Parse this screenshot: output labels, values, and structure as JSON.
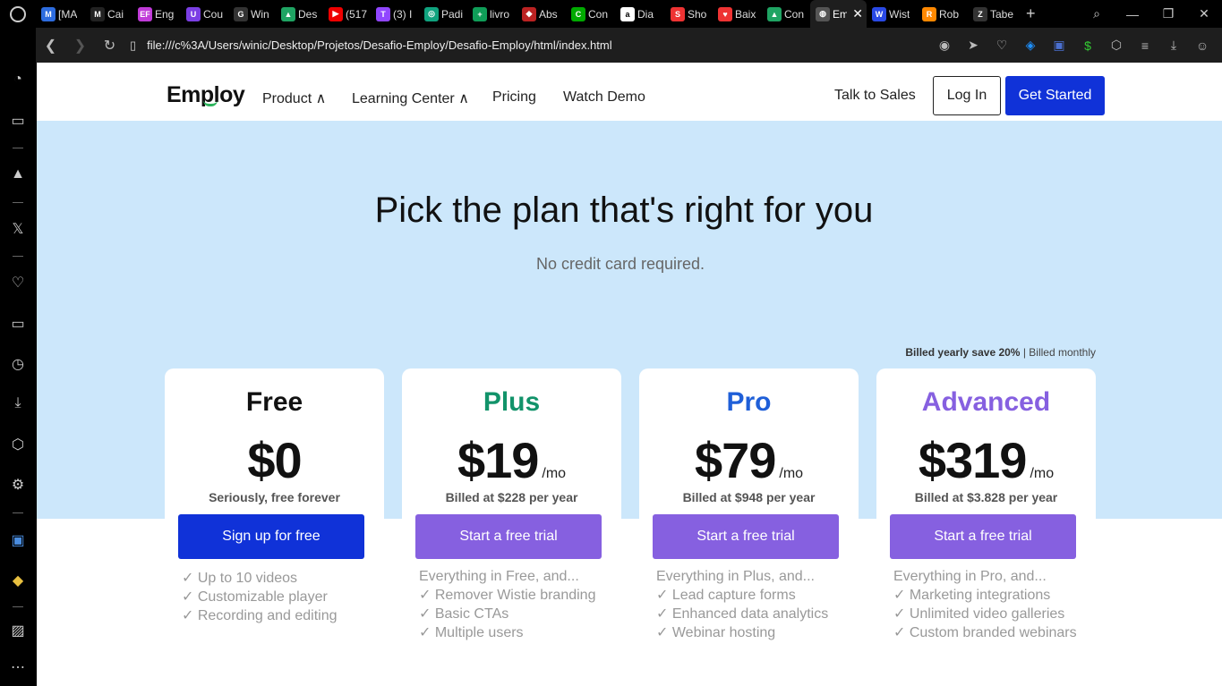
{
  "browser": {
    "tabs": [
      {
        "label": "[MA",
        "fav_color": "#2d6cdf",
        "fav_text": "M"
      },
      {
        "label": "Cai",
        "fav_color": "#222",
        "fav_text": "M"
      },
      {
        "label": "Eng",
        "fav_color": "#c03bd8",
        "fav_text": "EF"
      },
      {
        "label": "Cou",
        "fav_color": "#7b3fe4",
        "fav_text": "U"
      },
      {
        "label": "Win",
        "fav_color": "#333",
        "fav_text": "G"
      },
      {
        "label": "Des",
        "fav_color": "#1fa463",
        "fav_text": "▲"
      },
      {
        "label": "(517",
        "fav_color": "#e00",
        "fav_text": "▶"
      },
      {
        "label": "(3) I",
        "fav_color": "#9146ff",
        "fav_text": "T"
      },
      {
        "label": "Padi",
        "fav_color": "#10a37f",
        "fav_text": "◎"
      },
      {
        "label": "livro",
        "fav_color": "#0f9d58",
        "fav_text": "+"
      },
      {
        "label": "Abs",
        "fav_color": "#b22",
        "fav_text": "◆"
      },
      {
        "label": "Con",
        "fav_color": "#0a0",
        "fav_text": "C"
      },
      {
        "label": "Dia",
        "fav_color": "#fff",
        "fav_text": "a"
      },
      {
        "label": "Sho",
        "fav_color": "#e33",
        "fav_text": "S"
      },
      {
        "label": "Baix",
        "fav_color": "#e33",
        "fav_text": "♥"
      },
      {
        "label": "Con",
        "fav_color": "#1fa463",
        "fav_text": "▲"
      },
      {
        "label": "Em",
        "fav_color": "#555",
        "fav_text": "◍",
        "active": true
      },
      {
        "label": "Wist",
        "fav_color": "#2949e5",
        "fav_text": "W"
      },
      {
        "label": "Rob",
        "fav_color": "#f80",
        "fav_text": "R"
      },
      {
        "label": "Tabe",
        "fav_color": "#333",
        "fav_text": "Z"
      }
    ],
    "new_tab": "+",
    "url": "file:///c%3A/Users/winic/Desktop/Projetos/Desafio-Employ/Desafio-Employ/html/index.html"
  },
  "nav": {
    "logo": "Employ",
    "links": [
      "Product ∧",
      "Learning Center ∧",
      "Pricing",
      "Watch Demo"
    ],
    "talk": "Talk to Sales",
    "login": "Log In",
    "get_started": "Get Started"
  },
  "hero": {
    "title": "Pick the plan that's right for you",
    "subtitle": "No credit card required."
  },
  "billing": {
    "yearly": "Billed yearly save 20%",
    "separator": "|",
    "monthly": "Billed monthly"
  },
  "plans": [
    {
      "name": "Free",
      "color": "#111111",
      "price": "$0",
      "per": "",
      "billed": "Seriously, free forever",
      "cta": "Sign up for free",
      "intro": "",
      "features": [
        "✓ Up to 10 videos",
        "✓ Customizable player",
        "✓ Recording and editing"
      ]
    },
    {
      "name": "Plus",
      "color": "#12936a",
      "price": "$19",
      "per": "/mo",
      "billed": "Billed at $228 per year",
      "cta": "Start a free trial",
      "intro": "Everything in Free, and...",
      "features": [
        "✓ Remover Wistie branding",
        "✓ Basic CTAs",
        "✓ Multiple users"
      ]
    },
    {
      "name": "Pro",
      "color": "#1f5fd8",
      "price": "$79",
      "per": "/mo",
      "billed": "Billed at $948 per year",
      "cta": "Start a free trial",
      "intro": "Everything in Plus, and...",
      "features": [
        "✓ Lead capture forms",
        "✓ Enhanced data analytics",
        "✓ Webinar hosting"
      ]
    },
    {
      "name": "Advanced",
      "color": "#8660e0",
      "price": "$319",
      "per": "/mo",
      "billed": "Billed at $3.828 per year",
      "cta": "Start a free trial",
      "intro": "Everything in Pro, and...",
      "features": [
        "✓ Marketing integrations",
        "✓ Unlimited video galleries",
        "✓ Custom branded webinars"
      ]
    }
  ]
}
